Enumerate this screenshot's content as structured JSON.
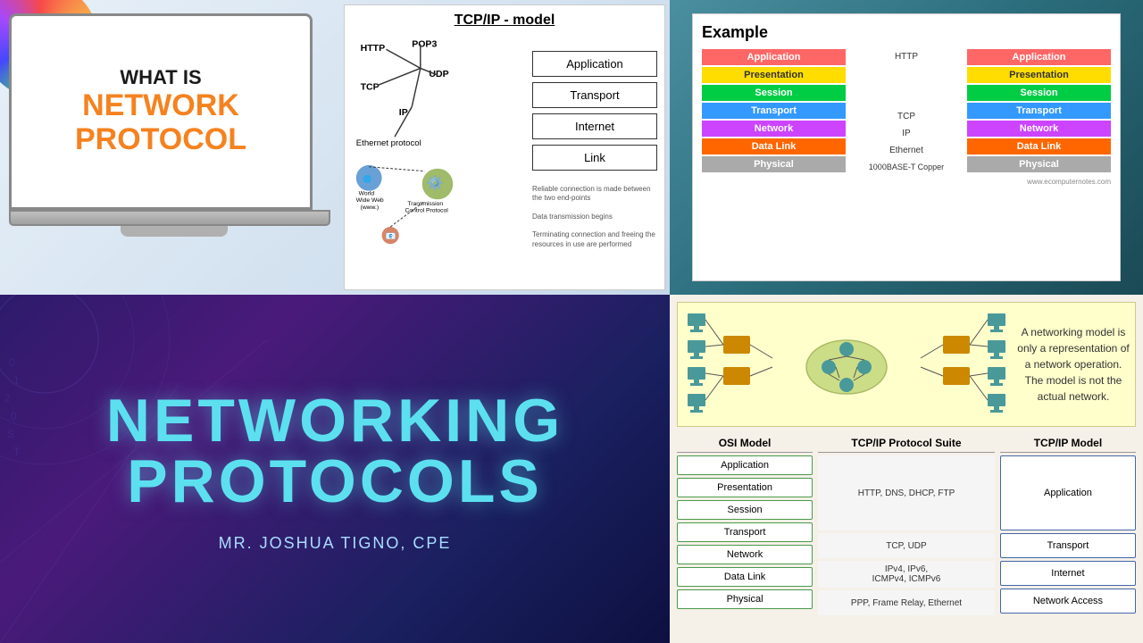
{
  "panels": {
    "topLeft": {
      "laptop": {
        "whatIs": "WHAT IS",
        "networkProtocol": "NETWORK\nPROTOCOL"
      },
      "tcpip": {
        "title": "TCP/IP - model",
        "layers": [
          "Application",
          "Transport",
          "Internet",
          "Link"
        ],
        "protocols": {
          "http": "HTTP",
          "pop3": "POP3",
          "udp": "UDP",
          "tcp": "TCP",
          "ip": "IP",
          "ethernet": "Ethernet protocol"
        },
        "descriptions": {
          "reliable": "Reliable connection is made between the two end-points",
          "transmission": "Data transmission begins",
          "terminating": "Terminating connection and freeing the resources in use are performed"
        }
      }
    },
    "topRight": {
      "example": {
        "title": "Example",
        "left_label": "HTTP",
        "right_label": "",
        "tcp_label": "TCP",
        "ip_label": "IP",
        "ethernet_label": "Ethernet",
        "copper_label": "1000BASE-T Copper",
        "layers_left": [
          "Application",
          "Presentation",
          "Session",
          "Transport",
          "Network",
          "Data Link",
          "Physical"
        ],
        "layers_right": [
          "Application",
          "Presentation",
          "Session",
          "Transport",
          "Network",
          "Data Link",
          "Physical"
        ]
      }
    },
    "bottomLeft": {
      "title1": "NETWORKING",
      "title2": "PROTOCOLS",
      "author": "MR. JOSHUA TIGNO, CPE"
    },
    "bottomRight": {
      "diagram_text": "A networking model is only a\nrepresentation of a network operation.\nThe model is not the actual network.",
      "osi_header": "OSI Model",
      "tcpip_suite_header": "TCP/IP Protocol  Suite",
      "tcpip_model_header": "TCP/IP Model",
      "osi_layers": [
        "Application",
        "Presentation",
        "Session",
        "Transport",
        "Network",
        "Data Link",
        "Physical"
      ],
      "tcpip_suite": [
        "HTTP, DNS, DHCP, FTP",
        "TCP, UDP",
        "IPv4, IPv6,\nICMPv4, ICMPv6",
        "PPP, Frame Relay, Ethernet"
      ],
      "tcpip_model_layers": [
        "Application",
        "Transport",
        "Internet",
        "Network Access"
      ]
    }
  }
}
